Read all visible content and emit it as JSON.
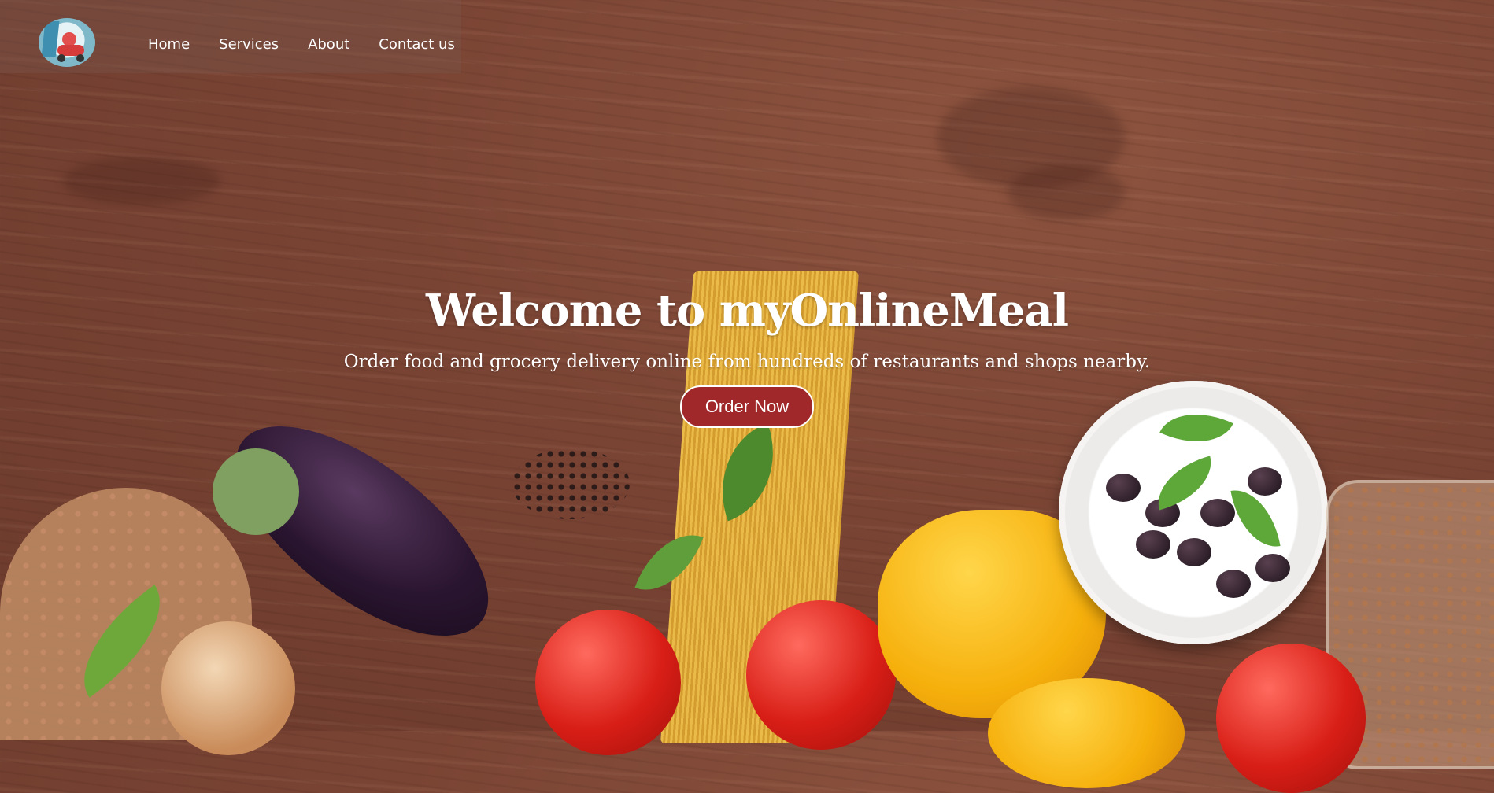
{
  "nav": {
    "logo_icon": "delivery-scooter-logo",
    "links": [
      {
        "label": "Home"
      },
      {
        "label": "Services"
      },
      {
        "label": "About"
      },
      {
        "label": "Contact us"
      }
    ]
  },
  "hero": {
    "title": "Welcome to myOnlineMeal",
    "subtitle": "Order food and grocery delivery online from hundreds of restaurants and shops nearby.",
    "cta_label": "Order Now"
  },
  "colors": {
    "accent": "#a0282a",
    "text": "#ffffff",
    "wood": "#7a4434"
  }
}
